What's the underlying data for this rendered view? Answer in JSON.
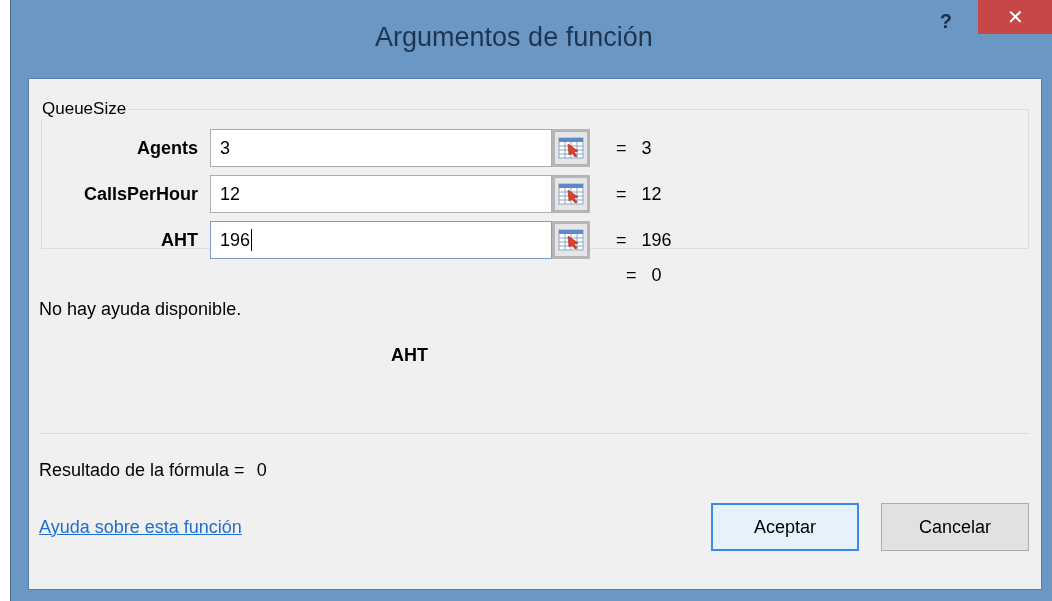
{
  "window": {
    "title": "Argumentos de función",
    "help_button": "?",
    "close_button": "✕"
  },
  "function": {
    "name": "QueueSize",
    "arguments": [
      {
        "label": "Agents",
        "value": "3",
        "result": "= 3",
        "focused": false
      },
      {
        "label": "CallsPerHour",
        "value": "12",
        "result": "= 12",
        "focused": false
      },
      {
        "label": "AHT",
        "value": "196",
        "result": "= 196",
        "focused": true
      }
    ]
  },
  "function_result": "= 0",
  "description": "No hay ayuda disponible.",
  "argument_help": "AHT",
  "formula_result": {
    "label": "Resultado de la fórmula =",
    "value": "0"
  },
  "help_link": "Ayuda sobre esta función",
  "buttons": [
    {
      "label": "Aceptar",
      "default": true
    },
    {
      "label": "Cancelar",
      "default": false
    }
  ]
}
